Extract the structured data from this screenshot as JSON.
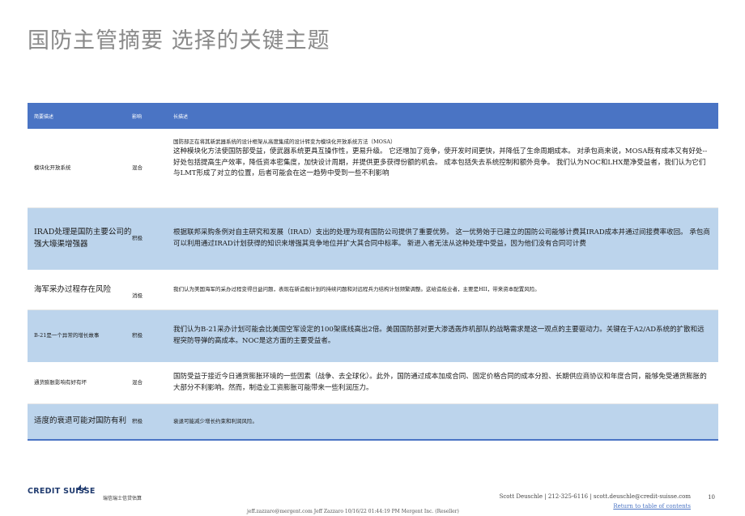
{
  "page_title": "国防主管摘要 选择的关键主题",
  "table": {
    "headers": [
      "简要描述",
      "影响",
      "长描述"
    ],
    "rows": [
      {
        "topic": "模块化开放系统",
        "impact": "混合",
        "note": "国防部正在将其新武器系统的设计框架从高度集成的设计转变为模块化开放系统方法（MOSA）",
        "description": "这种模块化方法使国防部受益，使武器系统更具互操作性，更易升级。 它还增加了竞争，使开发时间更快，并降低了生命周期成本。 对承包商来说，MOSA既有成本又有好处--好处包括提高生产效率，降低资本密集度，加快设计周期，并提供更多获得份额的机会。 成本包括失去系统控制和额外竞争。 我们认为NOC和LHX是净受益者，我们认为它们与LMT形成了对立的位置，后者可能会在这一趋势中受到一些不利影响"
      },
      {
        "topic": "IRAD处理是国防主要公司的强大壕渠增强器",
        "impact": "积极",
        "description": "根据联邦采购条例对自主研究和发展（IRAD）支出的处理为现有国防公司提供了重要优势。 这一优势始于已建立的国防公司能够计费其IRAD成本并通过间接费率收回。 承包商可以利用通过IRAD计划获得的知识来增强其竞争地位并扩大其合同中标率。 新进入者无法从这种处理中受益，因为他们没有合同可计费"
      },
      {
        "topic": "海军采办过程存在风险",
        "impact": "消极",
        "description": "我们认为美国海军的采办过程变得日益问题，表现在新造舰计划的持续问题和对远程兵力结构计划频繁调整。这给造船业者，主要是HII，带来资本配置风险。"
      },
      {
        "topic": "B-21是一个异常的增长故事",
        "impact": "积极",
        "description": "我们认为B-21采办计划可能会比美国空军设定的100架底线高出2倍。美国国防部对更大渗透轰炸机部队的战略需求是这一观点的主要驱动力。关键在于A2/AD系统的扩散和远程突防导弹的高成本。NOC是这方面的主要受益者。"
      },
      {
        "topic": "通货膨胀影响有好有坏",
        "impact": "混合",
        "description": "国防受益于接近今日通货膨胀环境的一些因素（战争、去全球化）。此外，国防通过成本加成合同、固定价格合同的成本分担、长期供应商协议和年度合同，能够免受通货膨胀的大部分不利影响。然而，制造业工资膨胀可能带来一些利润压力。"
      },
      {
        "topic": "适度的衰退可能对国防有利",
        "impact": "积极",
        "description": "衰退可能减少增长约束和利润风险。"
      }
    ]
  },
  "footer": {
    "logo_text": "CREDIT SUISSE",
    "source": "瑞信瑞士信贷估算",
    "contact": "Scott Deuschle | 212-325-6116 | scott.deuschle@credit-suisse.com",
    "page_number": "10",
    "return_link": "Return to table of contents",
    "watermark": "jeff.zazzaro@mergent.com Jeff Zazzaro 10/16/22 01:44:19 PM Mergent Inc. (Reseller)"
  },
  "colors": {
    "header_blue": "#4a74c4",
    "row_blue": "#bcd4ec",
    "title_gray": "#8a8a8a"
  }
}
